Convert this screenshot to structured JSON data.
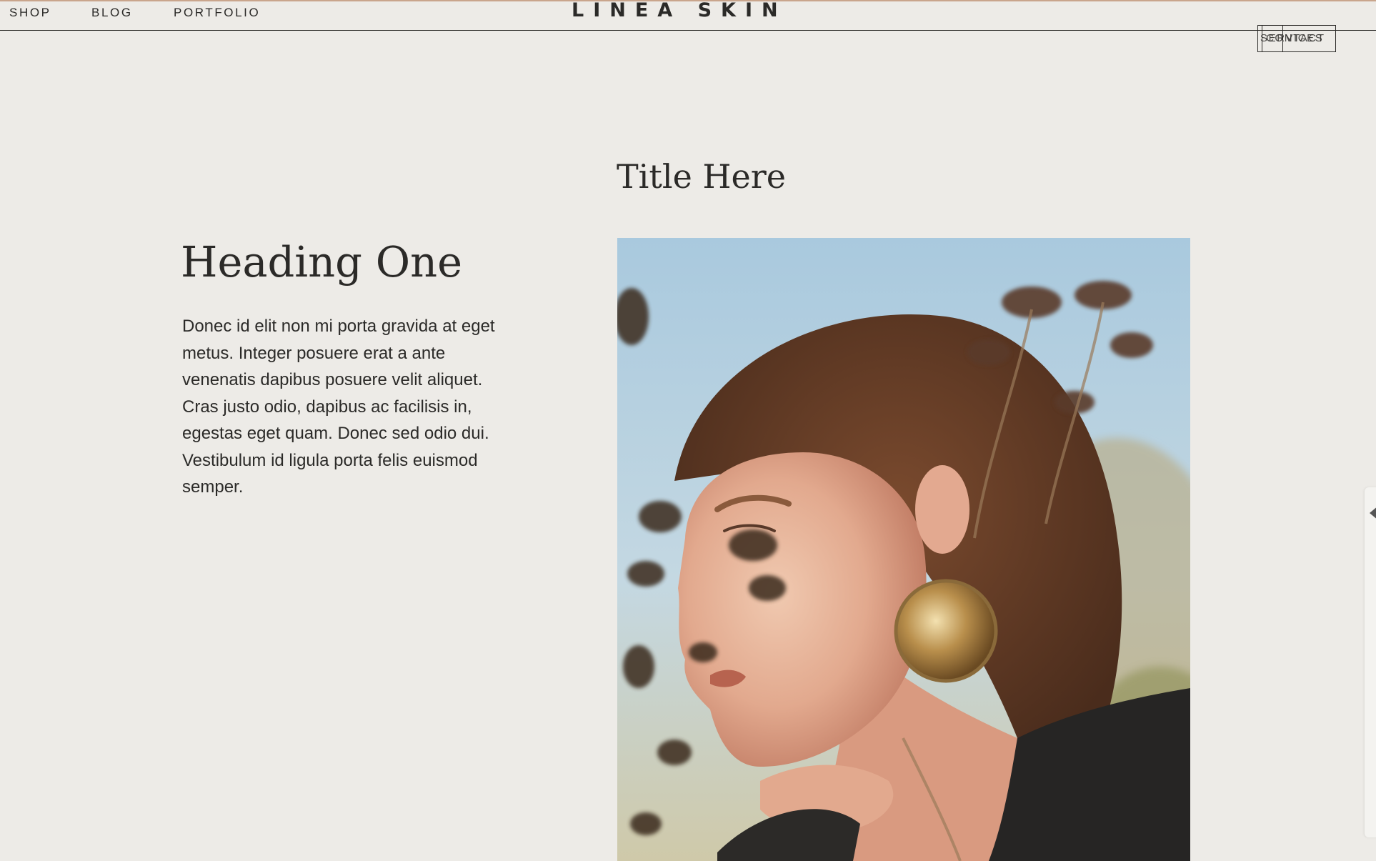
{
  "header": {
    "nav": [
      "SHOP",
      "BLOG",
      "PORTFOLIO"
    ],
    "logo": "LINEA SKIN",
    "right_nav": [
      "SERVICES",
      "CONTACT"
    ]
  },
  "main": {
    "title": "Title Here",
    "heading": "Heading One",
    "body": "Donec id elit non mi porta gravida at eget metus. Integer posuere erat a ante venenatis dapibus posuere velit aliquet. Cras justo odio, dapibus ac facilisis in, egestas eget quam. Donec sed odio dui. Vestibulum id ligula porta felis euismod semper."
  },
  "colors": {
    "background": "#edebe7",
    "text": "#2b2a28",
    "accent_rule": "#c9a58c"
  },
  "icons": {
    "side_tab": "chevron-left-icon"
  }
}
